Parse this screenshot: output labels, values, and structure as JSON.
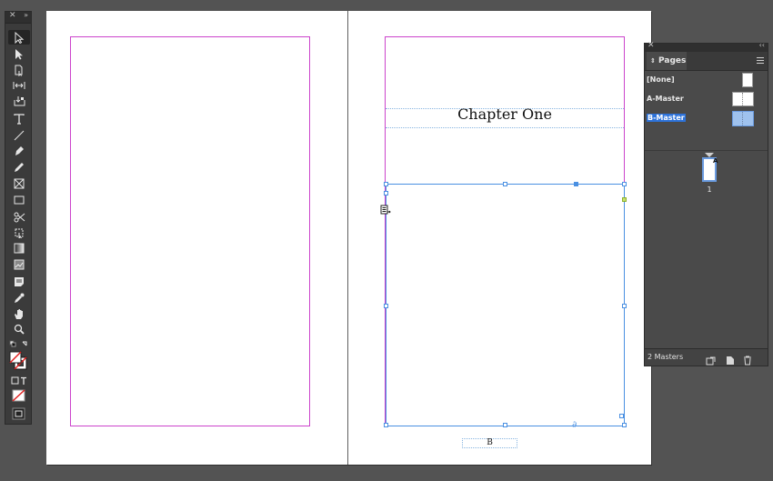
{
  "toolbar": {
    "tools": [
      {
        "name": "selection-tool-icon",
        "active": true
      },
      {
        "name": "direct-selection-tool-icon"
      },
      {
        "name": "page-tool-icon"
      },
      {
        "name": "gap-tool-icon"
      },
      {
        "name": "content-collector-tool-icon"
      },
      {
        "name": "type-tool-icon"
      },
      {
        "name": "line-tool-icon"
      },
      {
        "name": "pen-tool-icon"
      },
      {
        "name": "pencil-tool-icon"
      },
      {
        "name": "rectangle-frame-tool-icon"
      },
      {
        "name": "rectangle-tool-icon"
      },
      {
        "name": "scissors-tool-icon"
      },
      {
        "name": "free-transform-tool-icon"
      },
      {
        "name": "gradient-swatch-tool-icon"
      },
      {
        "name": "gradient-feather-tool-icon"
      },
      {
        "name": "note-tool-icon"
      },
      {
        "name": "eyedropper-tool-icon"
      },
      {
        "name": "hand-tool-icon"
      },
      {
        "name": "zoom-tool-icon"
      }
    ]
  },
  "document": {
    "chapter_title": "Chapter One",
    "page_marker": "B"
  },
  "pages_panel": {
    "tab_label": "Pages",
    "masters": [
      {
        "label": "[None]",
        "selected": false
      },
      {
        "label": "A-Master",
        "selected": false
      },
      {
        "label": "B-Master",
        "selected": true
      }
    ],
    "page_thumb_prefix": "A",
    "page_number": "1",
    "footer_text": "2 Masters"
  },
  "colors": {
    "margin_guide": "#cc44cc",
    "frame_selection": "#4a90e2",
    "selection_highlight": "#2d72d9"
  }
}
